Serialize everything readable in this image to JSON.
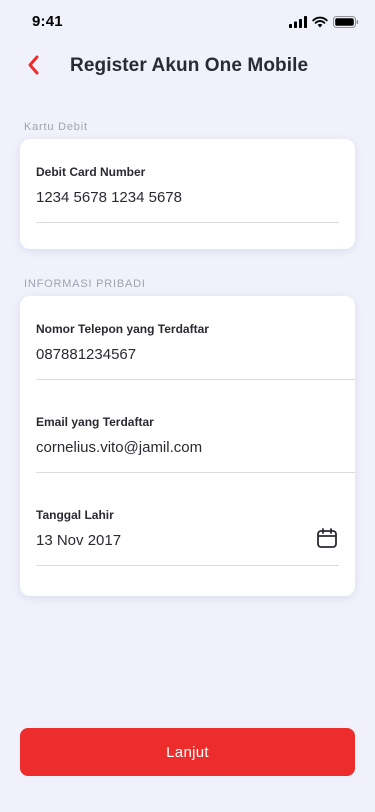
{
  "status_bar": {
    "time": "9:41",
    "icons": [
      "signal-icon",
      "wifi-icon",
      "battery-icon"
    ]
  },
  "header": {
    "back_icon": "chevron-left-icon",
    "title": "Register Akun One Mobile"
  },
  "sections": {
    "debit": {
      "label": "Kartu Debit",
      "fields": {
        "card_number": {
          "label": "Debit  Card Number",
          "value": "1234 5678 1234 5678"
        }
      }
    },
    "personal": {
      "label": "INFORMASI PRIBADI",
      "fields": {
        "phone": {
          "label": "Nomor Telepon yang Terdaftar",
          "value": "087881234567"
        },
        "email": {
          "label": "Email yang Terdaftar",
          "value": "cornelius.vito@jamil.com"
        },
        "birthdate": {
          "label": "Tanggal Lahir",
          "value": "13 Nov 2017",
          "icon": "calendar-icon"
        }
      }
    }
  },
  "actions": {
    "submit_label": "Lanjut"
  },
  "colors": {
    "background": "#F0F1FA",
    "accent": "#EC2D2B",
    "card": "#FFFFFF",
    "text": "#2A2A33",
    "muted": "#A0A2AE"
  }
}
